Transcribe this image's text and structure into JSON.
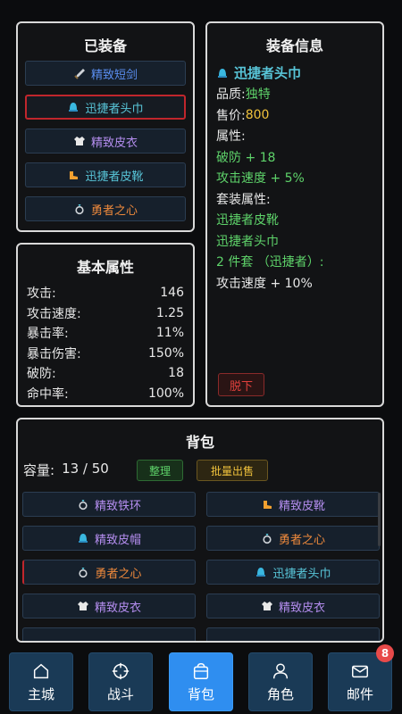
{
  "equipped": {
    "title": "已装备",
    "items": [
      {
        "label": "精致短剑",
        "color": "#5a8ef0",
        "icon": "sword-icon"
      },
      {
        "label": "迅捷者头巾",
        "color": "#58c5d8",
        "icon": "helmet-icon"
      },
      {
        "label": "精致皮衣",
        "color": "#b58ef0",
        "icon": "armor-icon"
      },
      {
        "label": "迅捷者皮靴",
        "color": "#58c5d8",
        "icon": "boots-icon"
      },
      {
        "label": "勇者之心",
        "color": "#f08a3c",
        "icon": "ring-icon"
      }
    ]
  },
  "stats": {
    "title": "基本属性",
    "rows": [
      {
        "name": "攻击:",
        "value": "146"
      },
      {
        "name": "攻击速度:",
        "value": "1.25"
      },
      {
        "name": "暴击率:",
        "value": "11%"
      },
      {
        "name": "暴击伤害:",
        "value": "150%"
      },
      {
        "name": "破防:",
        "value": "18"
      },
      {
        "name": "命中率:",
        "value": "100%"
      }
    ]
  },
  "info": {
    "title": "装备信息",
    "item_name": "迅捷者头巾",
    "quality_label": "品质:",
    "quality_value": "独特",
    "price_label": "售价:",
    "price_value": "800",
    "attr_label": "属性:",
    "attr_lines": [
      "破防 + 18",
      "攻击速度 + 5%"
    ],
    "set_label": "套装属性:",
    "set_items": [
      "迅捷者皮靴",
      "迅捷者头巾"
    ],
    "set_bonus_label": "2 件套 （迅捷者）:",
    "set_bonus": "攻击速度 + 10%",
    "unequip_label": "脱下",
    "colors": {
      "green": "#5ed36a",
      "gold": "#f0c23c",
      "cyan": "#58c5d8",
      "red": "#e0403c"
    }
  },
  "bag": {
    "title": "背包",
    "capacity_label": "容量:",
    "capacity_value": "13 / 50",
    "sort_label": "整理",
    "bulk_sell_label": "批量出售",
    "items": [
      {
        "label": "精致铁环",
        "color": "#b58ef0",
        "icon": "ring-icon"
      },
      {
        "label": "精致皮靴",
        "color": "#b58ef0",
        "icon": "boots-icon"
      },
      {
        "label": "精致皮帽",
        "color": "#b58ef0",
        "icon": "helmet-icon"
      },
      {
        "label": "勇者之心",
        "color": "#f08a3c",
        "icon": "ring-icon"
      },
      {
        "label": "勇者之心",
        "color": "#f08a3c",
        "icon": "ring-icon"
      },
      {
        "label": "迅捷者头巾",
        "color": "#58c5d8",
        "icon": "helmet-icon"
      },
      {
        "label": "精致皮衣",
        "color": "#b58ef0",
        "icon": "armor-icon"
      },
      {
        "label": "精致皮衣",
        "color": "#b58ef0",
        "icon": "armor-icon"
      }
    ]
  },
  "nav": {
    "tabs": [
      {
        "label": "主城",
        "icon": "home-icon"
      },
      {
        "label": "战斗",
        "icon": "crosshair-icon"
      },
      {
        "label": "背包",
        "icon": "bag-icon",
        "active": true
      },
      {
        "label": "角色",
        "icon": "person-icon"
      },
      {
        "label": "邮件",
        "icon": "mail-icon",
        "badge": "8"
      }
    ]
  }
}
